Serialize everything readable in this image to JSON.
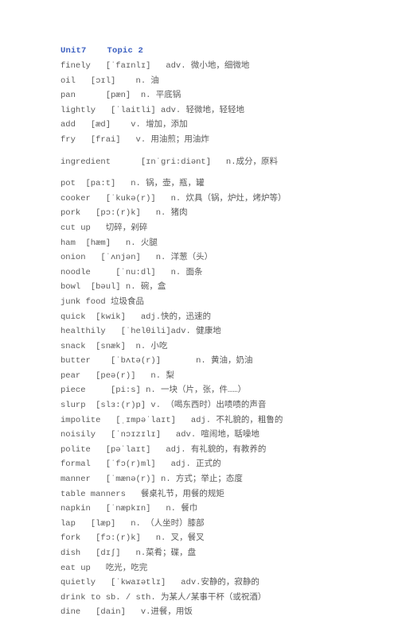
{
  "document": {
    "header": "Unit7    Topic 2",
    "header_color": "#3b5fc0",
    "body_color": "#5a5a5a",
    "background_color": "#ffffff"
  },
  "entries": [
    {
      "line": "finely   [ˈfaɪnlɪ]   adv. 微小地，细微地",
      "gap_before": false
    },
    {
      "line": "oil   [ɔɪl]    n. 油",
      "gap_before": false
    },
    {
      "line": "pan      [pæn]  n. 平底锅",
      "gap_before": false
    },
    {
      "line": "lightly   [ˈlaitli] adv. 轻微地，轻轻地",
      "gap_before": false
    },
    {
      "line": "add   [æd]    v. 增加，添加",
      "gap_before": false
    },
    {
      "line": "fry   [frai]   v. 用油煎；用油炸",
      "gap_before": false
    },
    {
      "line": "ingredient      [ɪnˈgri:diənt]   n.成分，原料",
      "gap_before": true
    },
    {
      "line": "pot  [pa:t]   n. 锅，壶，瓶，罐",
      "gap_before": true
    },
    {
      "line": "cooker   [ˈkukə(r)]   n. 炊具（锅，炉灶，烤炉等）",
      "gap_before": false
    },
    {
      "line": "pork   [pɔ:(r)k]   n. 猪肉",
      "gap_before": false
    },
    {
      "line": "cut up   切碎，剁碎",
      "gap_before": false
    },
    {
      "line": "ham  [hæm]   n. 火腿",
      "gap_before": false
    },
    {
      "line": "onion   [ˈʌnjən]   n. 洋葱（头）",
      "gap_before": false
    },
    {
      "line": "noodle     [ˈnu:dl]   n. 面条",
      "gap_before": false
    },
    {
      "line": "bowl  [bəul] n. 碗，盒",
      "gap_before": false
    },
    {
      "line": "junk food 垃圾食品",
      "gap_before": false
    },
    {
      "line": "quick  [kwik]   adj.快的，迅速的",
      "gap_before": false
    },
    {
      "line": "healthily   [ˈhelθili]adv. 健康地",
      "gap_before": false
    },
    {
      "line": "snack  [snæk]  n. 小吃",
      "gap_before": false
    },
    {
      "line": "butter    [ˈbʌtə(r)]       n. 黄油，奶油",
      "gap_before": false
    },
    {
      "line": "pear   [peə(r)]   n. 梨",
      "gap_before": false
    },
    {
      "line": "piece     [pi:s] n. 一块（片，张，件……）",
      "gap_before": false
    },
    {
      "line": "slurp  [slɜ:(r)p] v. （喝东西时）出啧啧的声音",
      "gap_before": false
    },
    {
      "line": "impolite   [ˌɪmpəˈlaɪt]   adj. 不礼貌的，粗鲁的",
      "gap_before": false
    },
    {
      "line": "noisily   [ˈnɔɪzɪlɪ]   adv. 喧闹地，聒噪地",
      "gap_before": false
    },
    {
      "line": "polite   [pəˈlaɪt]   adj. 有礼貌的，有教养的",
      "gap_before": false
    },
    {
      "line": "formal   [ˈfɔ(r)ml]   adj. 正式的",
      "gap_before": false
    },
    {
      "line": "manner   [ˈmænə(r)] n. 方式；举止；态度",
      "gap_before": false
    },
    {
      "line": "table manners   餐桌礼节，用餐的规矩",
      "gap_before": false
    },
    {
      "line": "napkin   [ˈnæpkɪn]   n. 餐巾",
      "gap_before": false
    },
    {
      "line": "lap   [læp]   n. （人坐时）膝部",
      "gap_before": false
    },
    {
      "line": "fork   [fɔ:(r)k]   n. 叉，餐叉",
      "gap_before": false
    },
    {
      "line": "dish   [dɪʃ]   n.菜肴；碟，盘",
      "gap_before": false
    },
    {
      "line": "eat up   吃光，吃完",
      "gap_before": false
    },
    {
      "line": "quietly   [ˈkwaɪətlɪ]   adv.安静的，寂静的",
      "gap_before": false
    },
    {
      "line": "drink to sb. / sth. 为某人/某事干杯（或祝酒）",
      "gap_before": false
    },
    {
      "line": "dine   [dain]   v.进餐，用饭",
      "gap_before": false
    }
  ]
}
